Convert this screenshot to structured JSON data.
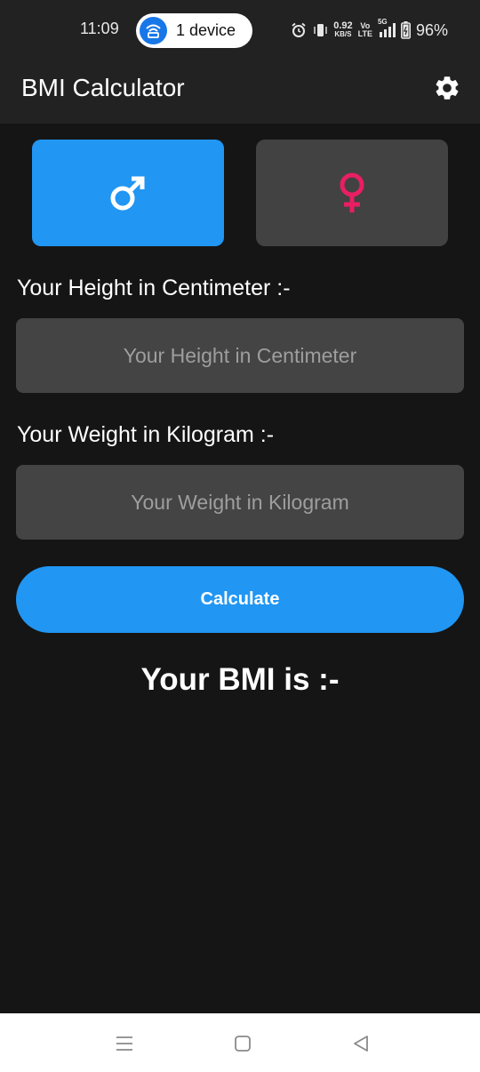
{
  "status_bar": {
    "time": "11:09",
    "hotspot_label": "1 device",
    "net_speed_value": "0.92",
    "net_speed_unit": "KB/S",
    "volte_top": "Vo",
    "volte_bottom": "LTE",
    "network_type": "5G",
    "battery_percent": "96%",
    "icons": [
      "wifi-hotspot-icon",
      "alarm-icon",
      "vibrate-icon",
      "signal-icon",
      "battery-icon"
    ]
  },
  "app_bar": {
    "title": "BMI Calculator",
    "settings_icon": "gear-icon"
  },
  "gender": {
    "male_icon": "male-symbol-icon",
    "female_icon": "female-symbol-icon",
    "selected": "male",
    "colors": {
      "selected_bg": "#2196f3",
      "unselected_bg": "#424242",
      "female_symbol": "#e91e63"
    }
  },
  "height": {
    "label": "Your Height in Centimeter :-",
    "placeholder": "Your Height in Centimeter",
    "value": ""
  },
  "weight": {
    "label": "Your Weight in Kilogram :-",
    "placeholder": "Your Weight in Kilogram",
    "value": ""
  },
  "calculate_button": {
    "label": "Calculate"
  },
  "result": {
    "text": "Your BMI is :-"
  },
  "nav_bar": {
    "icons": [
      "menu-icon",
      "home-icon",
      "back-icon"
    ]
  }
}
